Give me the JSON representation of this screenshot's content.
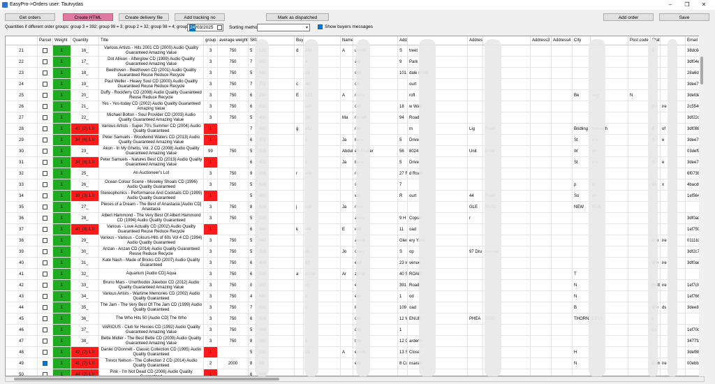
{
  "window": {
    "title": "EasyPro->Orders  user: Tautvydas",
    "minimize": "–",
    "maximize": "❐",
    "close": "✕"
  },
  "toolbar": {
    "get_orders": "Get orders",
    "create_html": "Create HTML",
    "create_delivery": "Create delivery file",
    "add_tracking": "Add tracking no",
    "mark_dispatched": "Mark as dispatched",
    "add_order": "Add order",
    "save": "Save"
  },
  "filters": {
    "quantities_label": "Quantities if different order groups: group 3 = 392; group 99 = 3; group 2 = 32; group 98 = 4; group 11 = 1",
    "date_selected": "24",
    "date_rest": "/03/2025",
    "sorting_label": "Sorting method",
    "sorting_value": "",
    "show_buyers_label": "Show buyers messages"
  },
  "colors": {
    "green": "#1faa1f",
    "red": "#ff1a1a",
    "pink": "#e07aa0",
    "accent": "#0078d7"
  },
  "columns": [
    "",
    "Parcel",
    "Weight",
    "Quantity",
    "Title",
    "group",
    "average weight",
    "SKU",
    "",
    "Buyer ID",
    "",
    "Name",
    "",
    "Address1",
    "",
    "Address2",
    "",
    "Address3",
    "Address4",
    "City",
    "",
    "Post code",
    "State",
    "",
    "Email"
  ],
  "rows": [
    {
      "n": "21",
      "checked": false,
      "weight": "1",
      "qty": "16_",
      "qty_red": false,
      "title": "Various Artists - Hits 2001 CD (2000) Audio Quality Guaranteed Amazing Value",
      "group": "3",
      "group_red": false,
      "avg": "750",
      "sku": "5",
      "sku2": "122",
      "buyer": "d",
      "buyer2": "968",
      "name": "A",
      "name2": "urchill",
      "addr1": "S",
      "addr1b": "treet",
      "addr2": "",
      "addr3": "",
      "city": "",
      "city2": "",
      "post": "",
      "state": "Z",
      "state2": "",
      "email": "38dc6c1"
    },
    {
      "n": "22",
      "checked": false,
      "weight": "1",
      "qty": "17_",
      "qty_red": false,
      "title": "Dot Allison - Afterglow CD (1999) Audio Quality Guaranteed Amazing Value",
      "group": "3",
      "group_red": false,
      "avg": "750",
      "sku": "7",
      "sku2": "952",
      "buyer": "",
      "buyer2": "4",
      "name": "",
      "name2": "aig",
      "addr1": "9",
      "addr1b": "Park",
      "addr2": "",
      "addr3": "",
      "city": "",
      "city2": "",
      "post": "",
      "state": "",
      "state2": "",
      "email": "3df04ed"
    },
    {
      "n": "23",
      "checked": false,
      "weight": "1",
      "qty": "18_",
      "qty_red": false,
      "title": "Beethoven - Beethoven CD (2001) Audio Quality Guaranteed Reuse Reduce Recycle",
      "group": "3",
      "group_red": false,
      "avg": "750",
      "sku": "5",
      "sku2": "662",
      "buyer": "",
      "buyer2": "01",
      "name": "",
      "name2": "sch",
      "addr1": "101 sp",
      "addr1b": "dale street",
      "addr2": "",
      "addr3": "",
      "city": "",
      "city2": "",
      "post": "",
      "state": "",
      "state2": "",
      "email": "28a6d8b"
    },
    {
      "n": "24",
      "checked": false,
      "weight": "1",
      "qty": "19_",
      "qty_red": false,
      "title": "Paul Weller - Heavy Soul CD (2000) Audio Quality Guaranteed Reuse Reduce Recycle",
      "group": "3",
      "group_red": false,
      "avg": "750",
      "sku": "7",
      "sku2": "772",
      "buyer": "c",
      "buyer2": "40",
      "name": "",
      "name2": "on",
      "addr1": "",
      "addr1b": "ourt",
      "addr2": "",
      "addr3": "",
      "city": "",
      "city2": "",
      "post": "",
      "state": "",
      "state2": "",
      "email": "3dee79e"
    },
    {
      "n": "25",
      "checked": false,
      "weight": "1",
      "qty": "20_",
      "qty_red": false,
      "title": "Duffy - Rockferry CD (2008) Audio Quality Guaranteed Reuse Reduce Recycle",
      "group": "3",
      "group_red": false,
      "avg": "750",
      "sku": "6",
      "sku2": "290",
      "buyer": "E",
      "buyer2": "123",
      "name": "A",
      "name2": "nson",
      "addr1": "",
      "addr1b": "roft",
      "addr2": "",
      "addr3": "",
      "city": "Be",
      "city2": "vey",
      "post": "N",
      "state": "",
      "state2": "",
      "email": "3defde9"
    },
    {
      "n": "26",
      "checked": false,
      "weight": "1",
      "qty": "21_",
      "qty_red": false,
      "title": "Yes - Yes-today CD (2002) Audio Quality Guaranteed Amazing Value",
      "group": "3",
      "group_red": false,
      "avg": "750",
      "sku": "6",
      "sku2": "811",
      "buyer": "",
      "buyer2": "vah",
      "name": "",
      "name2": "our",
      "addr1": "18",
      "addr1b": "w Way",
      "addr2": "",
      "addr3": "",
      "city": "",
      "city2": "",
      "post": "",
      "state": "No",
      "state2": "ire",
      "email": "2c55461"
    },
    {
      "n": "27",
      "checked": false,
      "weight": "1",
      "qty": "22_",
      "qty_red": false,
      "title": "Michael Bolton - Soul Provider CD (2003) Audio Quality Guaranteed Amazing Value",
      "group": "3",
      "group_red": false,
      "avg": "750",
      "sku": "5",
      "sku2": "432",
      "buyer": "",
      "buyer2": "70",
      "name": "Ma",
      "name2": "mmatt",
      "addr1": "94",
      "addr1b": "Road",
      "addr2": "",
      "addr3": "",
      "city": "",
      "city2": "",
      "post": "",
      "state": "",
      "state2": "",
      "email": "3df22c0"
    },
    {
      "n": "28",
      "checked": false,
      "weight": "1",
      "qty": "43_(2) 1.0",
      "qty_red": true,
      "title": "Various Artists - Super 70's Summer CD (2004) Audio Quality Guaranteed",
      "group": "1",
      "group_red": true,
      "avg": "",
      "sku": "7",
      "sku2": "892",
      "buyer": "g",
      "buyer2": "a53",
      "name": "",
      "name2": "ras",
      "addr1": "",
      "addr1b": "m",
      "addr2": "Lig",
      "addr2b": "Road",
      "addr3": "",
      "city": "Bridling",
      "city2": "borough",
      "post": "",
      "state": "E",
      "state2": "of",
      "email": "3df0885c"
    },
    {
      "n": "29",
      "checked": false,
      "weight": "1",
      "qty": "34_(6) 1.0",
      "qty_red": true,
      "title": "Peter Samuels - Woodwind Waters CD (2013) Audio Quality Guaranteed Amazing Value",
      "group": "1",
      "group_red": true,
      "avg": "",
      "sku": "6",
      "sku2": "372",
      "buyer": "",
      "buyer2": "1",
      "name": "Ja",
      "name2": "llace",
      "addr1": "5",
      "addr1b": "Drive",
      "addr2": "",
      "addr3": "",
      "city": "St",
      "city2": "ent",
      "post": "",
      "state": "S",
      "state2": "e",
      "email": "3dee742"
    },
    {
      "n": "30",
      "checked": false,
      "weight": "1",
      "qty": "23_",
      "qty_red": false,
      "title": "Akon - In My Ghetto, Vol. 2 CD (2008) Audio Quality Guaranteed Amazing Value",
      "group": "99",
      "group_red": false,
      "avg": "750",
      "sku": "5",
      "sku2": "025",
      "buyer": "",
      "buyer2": "",
      "name": "Abdul",
      "name2": "en Asaker",
      "addr1": "56",
      "addr1b": "8024",
      "addr2": "Unit",
      "addr2b": "Drive",
      "addr3": "",
      "city": "W",
      "city2": "on",
      "post": "",
      "state": "",
      "state2": "",
      "email": "03def9d"
    },
    {
      "n": "31",
      "checked": false,
      "weight": "1",
      "qty": "34_(6) 1.0",
      "qty_red": true,
      "title": "Peter Samuels - Natures Best CD (2013) Audio Quality Guaranteed Amazing Value",
      "group": "1",
      "group_red": true,
      "avg": "",
      "sku": "6",
      "sku2": "422",
      "buyer": "",
      "buyer2": "1",
      "name": "Ja",
      "name2": "llace",
      "addr1": "5",
      "addr1b": "Drive",
      "addr2": "",
      "addr3": "",
      "city": "St",
      "city2": "ent",
      "post": "",
      "state": "S",
      "state2": "e",
      "email": "3dee742"
    },
    {
      "n": "32",
      "checked": false,
      "weight": "1",
      "qty": "25_",
      "qty_red": false,
      "title": "An Auctioneer's Lot",
      "group": "3",
      "group_red": false,
      "avg": "750",
      "sku": "9",
      "sku2": "055",
      "buyer": "r",
      "buyer2": "e66",
      "name": "",
      "name2": "rs",
      "addr1": "27 R",
      "addr1b": "d Road",
      "addr2": "",
      "addr3": "",
      "city": "",
      "city2": "",
      "post": "",
      "state": "",
      "state2": "",
      "email": "6f07388"
    },
    {
      "n": "33",
      "checked": false,
      "weight": "1",
      "qty": "26_",
      "qty_red": false,
      "title": "Ocean Colour Scene - Moseley Shoals CD (1996) Audio Quality Guaranteed",
      "group": "3",
      "group_red": false,
      "avg": "750",
      "sku": "5",
      "sku2": "626",
      "buyer": "",
      "buyer2": "",
      "name": "",
      "name2": "s",
      "addr1": "7",
      "addr1b": "",
      "addr2": "",
      "addr3": "",
      "city": "p",
      "city2": "n",
      "post": "",
      "state": "W",
      "state2": "x",
      "email": "4bacdb7"
    },
    {
      "n": "34",
      "checked": false,
      "weight": "1",
      "qty": "39_(3) 1.0",
      "qty_red": true,
      "title": "Stereophonics - Performance And Cocktails CD (1999) Audio Quality Guaranteed",
      "group": "1",
      "group_red": true,
      "avg": "",
      "sku": "5",
      "sku2": "492",
      "buyer": "",
      "buyer2": "",
      "name": "",
      "name2": "wd",
      "addr1": "R",
      "addr1b": "ourt",
      "addr2": "44",
      "addr2b": "Road",
      "addr3": "",
      "city": "So",
      "city2": "on",
      "post": "",
      "state": "",
      "state2": "",
      "email": "1ef564c"
    },
    {
      "n": "35",
      "checked": false,
      "weight": "1",
      "qty": "27_",
      "qty_red": false,
      "title": "Pieces of a Dream - The Best of Anastacia [Audio CD] Anastacia",
      "group": "3",
      "group_red": false,
      "avg": "750",
      "sku": "8",
      "sku2": "629",
      "buyer": "j",
      "buyer2": "rick",
      "name": "Ja",
      "name2": "rnick",
      "addr1": "",
      "addr1b": "",
      "addr2": "GLE",
      "addr2b": "ROAD",
      "addr3": "",
      "city": "NEW",
      "city2": "RDS",
      "post": "",
      "state": "",
      "state2": "",
      "email": ""
    },
    {
      "n": "36",
      "checked": false,
      "weight": "1",
      "qty": "28_",
      "qty_red": false,
      "title": "Albert Hammond - The Very Best Of Albert Hammond CD (1994) Audio Quality Guaranteed",
      "group": "3",
      "group_red": false,
      "avg": "750",
      "sku": "5",
      "sku2": "016",
      "buyer": "",
      "buyer2": "",
      "name": "",
      "name2": "amin",
      "addr1": "9 H",
      "addr1b": "Copse",
      "addr2": "r",
      "addr3": "",
      "city": "",
      "city2": "",
      "post": "",
      "state": "",
      "state2": "",
      "email": "3df0ad2f"
    },
    {
      "n": "37",
      "checked": false,
      "weight": "1",
      "qty": "40_(8) 1.0",
      "qty_red": true,
      "title": "Various - Love Actually CD (2002) Audio Quality Guaranteed Reuse Reduce Recycle",
      "group": "1",
      "group_red": true,
      "avg": "",
      "sku": "6",
      "sku2": "349",
      "buyer": "k",
      "buyer2": "-44",
      "name": "E",
      "name2": "ield",
      "addr1": "11",
      "addr1b": "oad",
      "addr2": "",
      "addr3": "",
      "city": "",
      "city2": "",
      "post": "",
      "state": "",
      "state2": "",
      "email": "1ef750a"
    },
    {
      "n": "38",
      "checked": false,
      "weight": "1",
      "qty": "29_",
      "qty_red": false,
      "title": "Various - Various - Colours-Hits of 60s Vol 4 CD (1994) Audio Quality Guaranteed",
      "group": "3",
      "group_red": false,
      "avg": "750",
      "sku": "5",
      "sku2": "042",
      "buyer": "",
      "buyer2": "",
      "name": "",
      "name2": "ames",
      "addr1": "Glenho",
      "addr1b": "ery Yard,",
      "addr2": "",
      "addr3": "",
      "city": "",
      "city2": "",
      "post": "",
      "state": "Glo",
      "state2": "ire",
      "email": "0111b3a"
    },
    {
      "n": "39",
      "checked": false,
      "weight": "1",
      "qty": "30_",
      "qty_red": false,
      "title": "Anzan - Anzan CD (2014) Audio Quality Guaranteed Reuse Reduce Recycle",
      "group": "3",
      "group_red": false,
      "avg": "750",
      "sku": "5",
      "sku2": "325",
      "buyer": "",
      "buyer2": "s1",
      "name": "Jo",
      "name2": "ones",
      "addr1": "S",
      "addr1b": "op",
      "addr2": "97 Dru",
      "addr2b": "Avenue",
      "addr3": "",
      "city": "",
      "city2": "",
      "post": "",
      "state": "",
      "state2": "",
      "email": "3df2c74b"
    },
    {
      "n": "40",
      "checked": false,
      "weight": "1",
      "qty": "31_",
      "qty_red": false,
      "title": "Kate Nash - Made of Bricks CD (2007) Audio Quality Guaranteed",
      "group": "3",
      "group_red": false,
      "avg": "750",
      "sku": "6",
      "sku2": "436",
      "buyer": "",
      "buyer2": "87",
      "name": "",
      "name2": "ead",
      "addr1": "23 w",
      "addr1b": "venue",
      "addr2": "",
      "addr3": "",
      "city": "",
      "city2": "",
      "post": "",
      "state": "We",
      "state2": "ire",
      "email": "3df0ae8f"
    },
    {
      "n": "41",
      "checked": false,
      "weight": "1",
      "qty": "32_",
      "qty_red": false,
      "title": "Aquarium [Audio CD] Aqua",
      "group": "3",
      "group_red": false,
      "avg": "750",
      "sku": "6",
      "sku2": "018",
      "buyer": "a",
      "buyer2": "zzina",
      "name": "Ar",
      "name2": "zzina",
      "addr1": "40 S",
      "addr1b": "ROAD",
      "addr2": "",
      "addr3": "",
      "city": "T",
      "city2": "",
      "post": "",
      "state": "",
      "state2": "",
      "email": ""
    },
    {
      "n": "42",
      "checked": false,
      "weight": "1",
      "qty": "33_",
      "qty_red": false,
      "title": "Bruno Mars - Unorthodox Jukebox CD (2012) Audio Quality Guaranteed Amazing Value",
      "group": "3",
      "group_red": false,
      "avg": "750",
      "sku": "0",
      "sku2": "357",
      "buyer": "",
      "buyer2": "m",
      "name": "",
      "name2": "e",
      "addr1": "391",
      "addr1b": "Road",
      "addr2": "",
      "addr3": "",
      "city": "N",
      "city2": "",
      "post": "",
      "state": "Notti",
      "state2": "ire",
      "email": "1ef7cfd"
    },
    {
      "n": "43",
      "checked": false,
      "weight": "1",
      "qty": "34_",
      "qty_red": false,
      "title": "Various Artists - Wartime Memories CD (2002) Audio Quality Guaranteed",
      "group": "3",
      "group_red": false,
      "avg": "750",
      "sku": "4",
      "sku2": "680",
      "buyer": "",
      "buyer2": "9",
      "name": "",
      "name2": "ew",
      "addr1": "1",
      "addr1b": "od",
      "addr2": "",
      "addr3": "",
      "city": "N",
      "city2": "",
      "post": "",
      "state": "",
      "state2": "",
      "email": "1ef7663"
    },
    {
      "n": "44",
      "checked": false,
      "weight": "1",
      "qty": "35_",
      "qty_red": false,
      "title": "The Jam - The Very Best Of The Jam CD (1999) Audio Quality Guaranteed",
      "group": "3",
      "group_red": false,
      "avg": "750",
      "sku": "7",
      "sku2": "821",
      "buyer": "",
      "buyer2": "0",
      "name": "",
      "name2": "ll",
      "addr1": "109",
      "addr1b": "oad",
      "addr2": "",
      "addr3": "",
      "city": "B",
      "city2": "",
      "post": "",
      "state": "We",
      "state2": "ds",
      "email": "3dee828"
    },
    {
      "n": "45",
      "checked": false,
      "weight": "1",
      "qty": "36_",
      "qty_red": false,
      "title": "The Who Hits 50 [Audio CD] The Who",
      "group": "3",
      "group_red": false,
      "avg": "750",
      "sku": "6",
      "sku2": "029",
      "buyer": "",
      "buyer2": "",
      "name": "",
      "name2": "om",
      "addr1": "12 M",
      "addr1b": "ENUE",
      "addr2": "PHEA",
      "addr2b": "OOD",
      "addr3": "",
      "city": "THORNT",
      "city2": "LEYS",
      "post": "",
      "state": "L",
      "state2": "",
      "email": ""
    },
    {
      "n": "46",
      "checked": false,
      "weight": "1",
      "qty": "37_",
      "qty_red": false,
      "title": "VARIOUS - Club for Heroes CD (1992) Audio Quality Guaranteed Amazing Value",
      "group": "3",
      "group_red": false,
      "avg": "750",
      "sku": "5",
      "sku2": "066",
      "buyer": "",
      "buyer2": "",
      "name": "",
      "name2": "day",
      "addr1": "1",
      "addr1b": "",
      "addr2": "",
      "addr3": "",
      "city": "",
      "city2": "",
      "post": "",
      "state": "La",
      "state2": "",
      "email": "1ef70d4"
    },
    {
      "n": "47",
      "checked": false,
      "weight": "1",
      "qty": "38_",
      "qty_red": false,
      "title": "Bette Midler - The Best Bette CD (2009) Audio Quality Guaranteed Amazing Value",
      "group": "3",
      "group_red": false,
      "avg": "750",
      "sku": "8",
      "sku2": "092",
      "buyer": "",
      "buyer2": "8",
      "name": "",
      "name2": "trno",
      "addr1": "12 Gre",
      "addr1b": "ardens",
      "addr2": "",
      "addr3": "",
      "city": "",
      "city2": "",
      "post": "",
      "state": "",
      "state2": "",
      "email": "3477fa6"
    },
    {
      "n": "48",
      "checked": false,
      "weight": "1",
      "qty": "42_(2) 1.0",
      "qty_red": true,
      "title": "Daniel O'Donnell - Classic Collection CD (1995) Audio Quality Guaranteed",
      "group": "1",
      "group_red": true,
      "avg": "",
      "sku": "5",
      "sku2": "011",
      "buyer": "",
      "buyer2": "01",
      "name": "A",
      "name2": "erson",
      "addr1": "13 S",
      "addr1b": "Close",
      "addr2": "",
      "addr3": "",
      "city": "H",
      "city2": "",
      "post": "",
      "state": "",
      "state2": "",
      "email": "3def88e"
    },
    {
      "n": "49",
      "checked": true,
      "weight": "1",
      "qty": "41_(2) 1.0",
      "qty_red": true,
      "title": "Trevor Nelson - The Collection 2 CD (2014) Audio Quality Guaranteed",
      "group": "2",
      "group_red": false,
      "avg": "2000",
      "sku": "8",
      "sku2": "88",
      "buyer": "",
      "buyer2": "",
      "name": "",
      "name2": "elly",
      "addr1": "8 Coed",
      "addr1b": "nsaran",
      "addr2": "",
      "addr3": "",
      "city": "N",
      "city2": "",
      "post": "",
      "state": "Cam",
      "state2": "ire",
      "email": "00ebbac"
    },
    {
      "n": "50",
      "checked": false,
      "weight": "1",
      "qty": "44_(2) 1.0",
      "qty_red": true,
      "title": "Pink - I'm Not Dead CD (2006) Audio Quality Guaranteed",
      "group": "1",
      "group_red": true,
      "avg": "",
      "sku": "6",
      "sku2": "004",
      "buyer": "",
      "buyer2": "",
      "name": "",
      "name2": "",
      "addr1": "",
      "addr1b": "",
      "addr2": "",
      "addr3": "",
      "city": "",
      "city2": "",
      "post": "",
      "state": "",
      "state2": "",
      "email": ""
    }
  ]
}
